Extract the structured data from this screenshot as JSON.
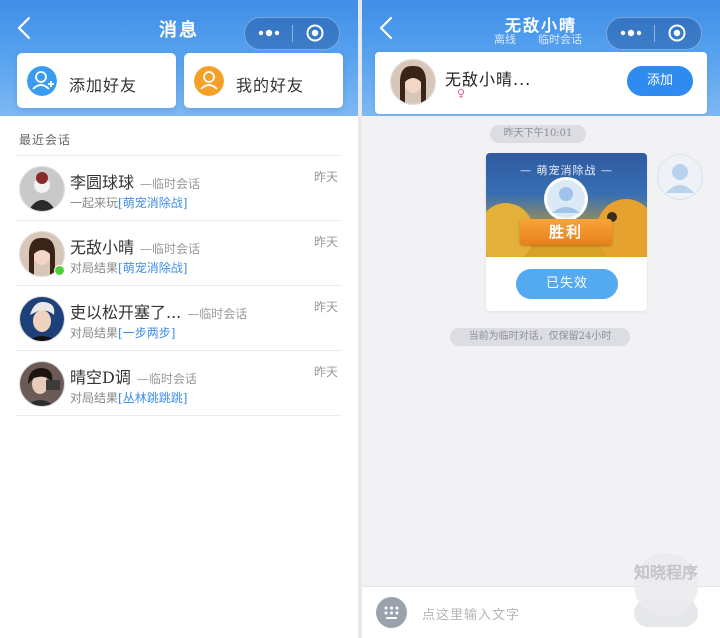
{
  "left": {
    "title": "消息",
    "cards": [
      {
        "label": "添加好友",
        "icon": "add-friend-icon",
        "color": "#3a9cf0"
      },
      {
        "label": "我的好友",
        "icon": "my-friends-icon",
        "color": "#f5a026"
      }
    ],
    "section_label": "最近会话",
    "conversations": [
      {
        "name": "李圆球球",
        "tag": "—临时会话",
        "preview_prefix": "一起来玩",
        "preview_link": "[萌宠消除战]",
        "time": "昨天",
        "online": false
      },
      {
        "name": "无敌小晴",
        "tag": "—临时会话",
        "preview_prefix": "对局结果",
        "preview_link": "[萌宠消除战]",
        "time": "昨天",
        "online": true
      },
      {
        "name": "吏以松开塞了...",
        "tag": "—临时会话",
        "preview_prefix": "对局结果",
        "preview_link": "[一步两步]",
        "time": "昨天",
        "online": false
      },
      {
        "name": "晴空D调",
        "tag": "—临时会话",
        "preview_prefix": "对局结果",
        "preview_link": "[丛林跳跳跳]",
        "time": "昨天",
        "online": false
      }
    ]
  },
  "right": {
    "title": "无敌小晴",
    "status": "离线",
    "session_type": "临时会话",
    "contact_name": "无敌小晴...",
    "gender_symbol": "♀",
    "add_label": "添加",
    "timestamp": "昨天下午10:01",
    "game_title": "— 萌宠消除战 —",
    "result_label": "胜利",
    "expired_label": "已失效",
    "notice": "当前为临时对话，仅保留24小时",
    "input_placeholder": "点这里输入文字"
  },
  "watermark": "知晓程序",
  "colors": {
    "header_blue": "#3f8ee8",
    "link_blue": "#3f8ee8",
    "online_green": "#4fcf37",
    "button_blue": "#2f8bf0"
  }
}
